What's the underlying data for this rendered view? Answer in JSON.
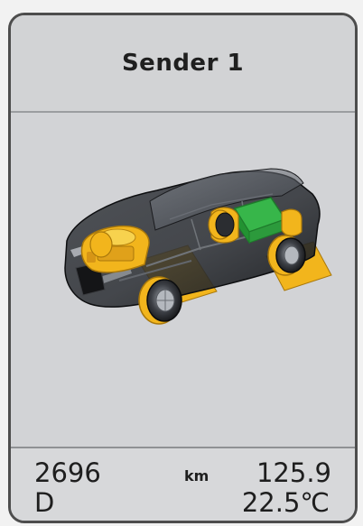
{
  "header": {
    "title": "Sender 1"
  },
  "status": {
    "odometer": "2696",
    "unit": "km",
    "value": "125.9",
    "gear": "D",
    "temperature": "22.5℃"
  },
  "vehicle": {
    "image": "car-cutaway-icon",
    "highlight_colors": {
      "components": "#f2b51c",
      "battery": "#37b64a"
    }
  }
}
